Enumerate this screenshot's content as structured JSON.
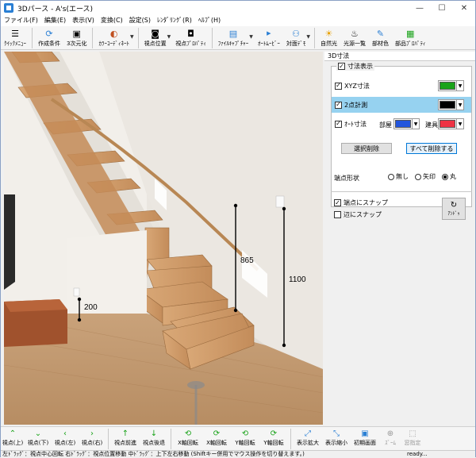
{
  "window": {
    "title": "3Dパース - A's(エース)",
    "minimize": "—",
    "maximize": "☐",
    "close": "✕"
  },
  "menu": [
    "ファイル(F)",
    "編集(E)",
    "表示(V)",
    "変換(C)",
    "設定(S)",
    "ﾚﾝﾀﾞﾘﾝｸﾞ(R)",
    "ﾍﾙﾌﾟ(H)"
  ],
  "toolbar": {
    "items": [
      {
        "label": "ｸｲｯｸﾒﾆｭｰ",
        "icon": "menu-icon"
      },
      {
        "label": "作成条件",
        "icon": "refresh-icon"
      },
      {
        "label": "3次元化",
        "icon": "printer-icon"
      },
      {
        "label": "ｶﾗｰｺｰﾃﾞｨﾈｰﾄ",
        "icon": "palette-icon"
      },
      {
        "label": "視点位置",
        "icon": "camera-icon"
      },
      {
        "label": "視点ﾌﾟﾛﾊﾟﾃｨ",
        "icon": "camera-settings-icon"
      },
      {
        "label": "ﾌｧｲﾙｷｬﾌﾟﾁｬｰ",
        "icon": "capture-icon"
      },
      {
        "label": "ｵｰﾄﾑｰﾋﾞｰ",
        "icon": "auto-movie-icon"
      },
      {
        "label": "対面ﾃﾞﾓ",
        "icon": "people-icon"
      },
      {
        "label": "自然光",
        "icon": "sun-icon"
      },
      {
        "label": "光源一覧",
        "icon": "lamp-icon"
      },
      {
        "label": "部材色",
        "icon": "paint-icon"
      },
      {
        "label": "部品ﾌﾟﾛﾊﾟﾃｨ",
        "icon": "parts-icon"
      }
    ]
  },
  "viewport": {
    "dimensions": [
      {
        "label": "865"
      },
      {
        "label": "1100"
      },
      {
        "label": "200"
      }
    ]
  },
  "panel": {
    "title": "3D寸法",
    "group_label": "寸法表示",
    "rows": [
      {
        "label": "XYZ寸法",
        "color": "#1aa31a"
      },
      {
        "label": "2点計測",
        "color": "#000000"
      },
      {
        "label": "ｵｰﾄ寸法",
        "sub1": "部屋",
        "color1": "#2255dd",
        "sub2": "建具",
        "color2": "#ee3344"
      }
    ],
    "delete_selected": "選択削除",
    "delete_all": "すべて削除する",
    "endpoint_label": "端点形状",
    "endpoint_options": [
      "無し",
      "矢印",
      "丸"
    ],
    "endpoint_selected": "丸",
    "snap_endpoint": "端点にスナップ",
    "snap_edge": "辺にスナップ",
    "undo": "ｱﾝﾄﾞｩ"
  },
  "bottombar": {
    "items": [
      {
        "label": "視点(上)",
        "icon": "chevron-up-icon"
      },
      {
        "label": "視点(下)",
        "icon": "chevron-down-icon"
      },
      {
        "label": "視点(左)",
        "icon": "chevron-left-icon"
      },
      {
        "label": "視点(右)",
        "icon": "chevron-right-icon"
      },
      {
        "label": "視点前進",
        "icon": "arrow-up-icon"
      },
      {
        "label": "視点後退",
        "icon": "arrow-down-icon"
      },
      {
        "label": "X軸回転",
        "icon": "rotate-x-icon"
      },
      {
        "label": "X軸回転",
        "icon": "rotate-x-reverse-icon"
      },
      {
        "label": "Y軸回転",
        "icon": "rotate-y-icon"
      },
      {
        "label": "Y軸回転",
        "icon": "rotate-y-reverse-icon"
      },
      {
        "label": "表示拡大",
        "icon": "zoom-in-icon"
      },
      {
        "label": "表示縮小",
        "icon": "zoom-out-icon"
      },
      {
        "label": "初期画面",
        "icon": "home-view-icon"
      },
      {
        "label": "ｽﾞｰﾑ",
        "icon": "zoom-icon"
      },
      {
        "label": "窓指定",
        "icon": "window-select-icon"
      }
    ]
  },
  "status": {
    "hint": "左ﾄﾞﾗｯｸﾞ：視点中心回転 右ﾄﾞﾗｯｸﾞ：視点位置移動 中ﾄﾞﾗｯｸﾞ：上下左右移動 (Shiftキー併用でマウス操作を切り替えます。)",
    "state": "ready..."
  }
}
